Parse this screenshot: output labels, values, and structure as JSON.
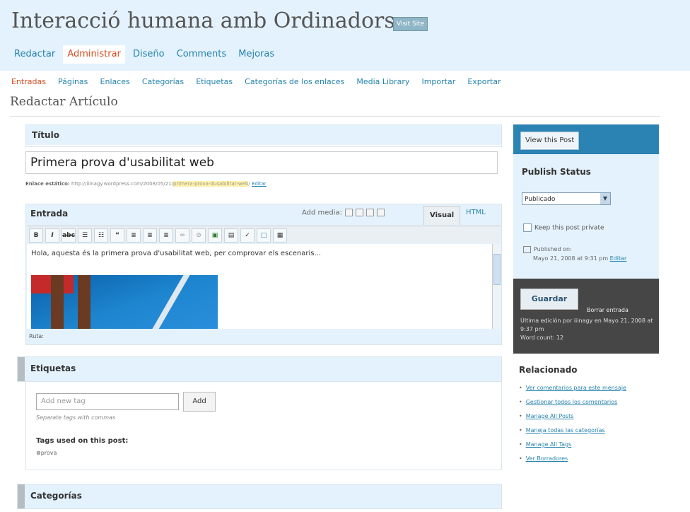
{
  "header": {
    "site_title": "Interacció humana amb Ordinadors",
    "visit_site": "Visit Site"
  },
  "main_nav": [
    {
      "label": "Redactar",
      "current": false
    },
    {
      "label": "Administrar",
      "current": true
    },
    {
      "label": "Diseño",
      "current": false
    },
    {
      "label": "Comments",
      "current": false
    },
    {
      "label": "Mejoras",
      "current": false
    }
  ],
  "sub_nav": [
    {
      "label": "Entradas",
      "current": true
    },
    {
      "label": "Páginas"
    },
    {
      "label": "Enlaces"
    },
    {
      "label": "Categorías"
    },
    {
      "label": "Etiquetas"
    },
    {
      "label": "Categorías de los enlaces"
    },
    {
      "label": "Media Library"
    },
    {
      "label": "Importar"
    },
    {
      "label": "Exportar"
    }
  ],
  "page_title": "Redactar Artículo",
  "title_box": {
    "label": "Título",
    "value": "Primera prova d'usabilitat web"
  },
  "permalink": {
    "label": "Enlace estático:",
    "base": "http://iiinagy.wordpress.com/2008/05/21/",
    "slug": "primera-prova-dusabilitat-web",
    "suffix": "/",
    "edit": "Editar"
  },
  "editor": {
    "label": "Entrada",
    "add_media": "Add media:",
    "tab_visual": "Visual",
    "tab_html": "HTML",
    "toolbar": {
      "bold": "B",
      "italic": "I",
      "strike": "abc",
      "ul": "☰",
      "ol": "☷",
      "quote": "“",
      "align_left": "≡",
      "align_center": "≡",
      "align_right": "≡",
      "link": "∞",
      "unlink": "⊘",
      "image": "▣",
      "more": "▤",
      "spell": "✓",
      "fullscreen": "□",
      "kitchen": "▦"
    },
    "content": "Hola, aquesta és la primera prova d'usabilitat web, per comprovar els escenaris...",
    "path": "Ruta:"
  },
  "tags": {
    "heading": "Etiquetas",
    "input_placeholder": "Add new tag",
    "add_button": "Add",
    "hint": "Separate tags with commas",
    "used_label": "Tags used on this post:",
    "used": [
      "prova"
    ]
  },
  "categories": {
    "heading": "Categorías"
  },
  "sidebar": {
    "view_post": "View this Post",
    "publish_status": "Publish Status",
    "status_value": "Publicado",
    "keep_private": "Keep this post private",
    "published_on_label": "Published on:",
    "published_on_date": "Mayo 21, 2008 at 9:31 pm",
    "published_edit": "Editar",
    "save": "Guardar",
    "delete": "Borrar entrada",
    "last_edit": "Última edición por iiinagy en Mayo 21, 2008 at 9:37 pm",
    "word_count": "Word count: 12"
  },
  "related": {
    "heading": "Relacionado",
    "links": [
      "Ver comentarios para este mensaje",
      "Gestionar todos los comentarios",
      "Manage All Posts",
      "Maneja todas las categorías",
      "Manage All Tags",
      "Ver Borradores"
    ]
  }
}
